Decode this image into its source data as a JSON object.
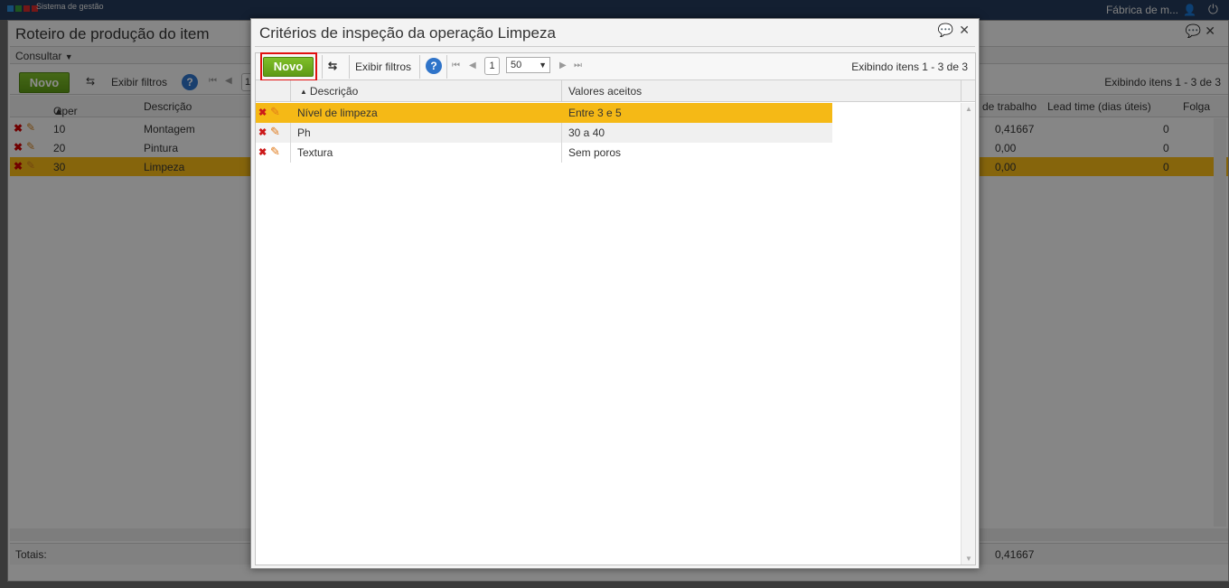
{
  "app": {
    "brand": "Sistema de gestão",
    "company": "Fábrica de m...",
    "logo_colors": [
      "#2b8ad6",
      "#3a9b3a",
      "#d32a2a"
    ]
  },
  "background": {
    "title": "Roteiro de produção do item",
    "consultar_label": "Consultar",
    "novo_label": "Novo",
    "filters_label": "Exibir filtros",
    "page": "1",
    "display_info": "Exibindo itens 1 - 3 de 3",
    "columns": {
      "oper": "Oper",
      "descricao": "Descrição",
      "trabalho": "de trabalho",
      "lead_time": "Lead time (dias úteis)",
      "folga": "Folga"
    },
    "rows": [
      {
        "oper": "10",
        "desc": "Montagem",
        "trabalho": "0,41667",
        "lead": "0"
      },
      {
        "oper": "20",
        "desc": "Pintura",
        "trabalho": "0,00",
        "lead": "0"
      },
      {
        "oper": "30",
        "desc": "Limpeza",
        "trabalho": "0,00",
        "lead": "0"
      }
    ],
    "totals_label": "Totais:",
    "totals_value": "0,41667"
  },
  "dialog": {
    "title": "Critérios de inspeção da operação Limpeza",
    "novo_label": "Novo",
    "filters_label": "Exibir filtros",
    "help": "?",
    "page": "1",
    "page_size": "50",
    "display_info": "Exibindo itens 1 - 3 de 3",
    "columns": {
      "descricao": "Descrição",
      "valores": "Valores aceitos"
    },
    "rows": [
      {
        "desc": "Nível de limpeza",
        "valores": "Entre 3 e 5"
      },
      {
        "desc": "Ph",
        "valores": "30 a 40"
      },
      {
        "desc": "Textura",
        "valores": "Sem poros"
      }
    ]
  },
  "colors": {
    "selected_row": "#f5b916",
    "novo_button": "#6aaa1c",
    "highlight": "#e01010"
  }
}
